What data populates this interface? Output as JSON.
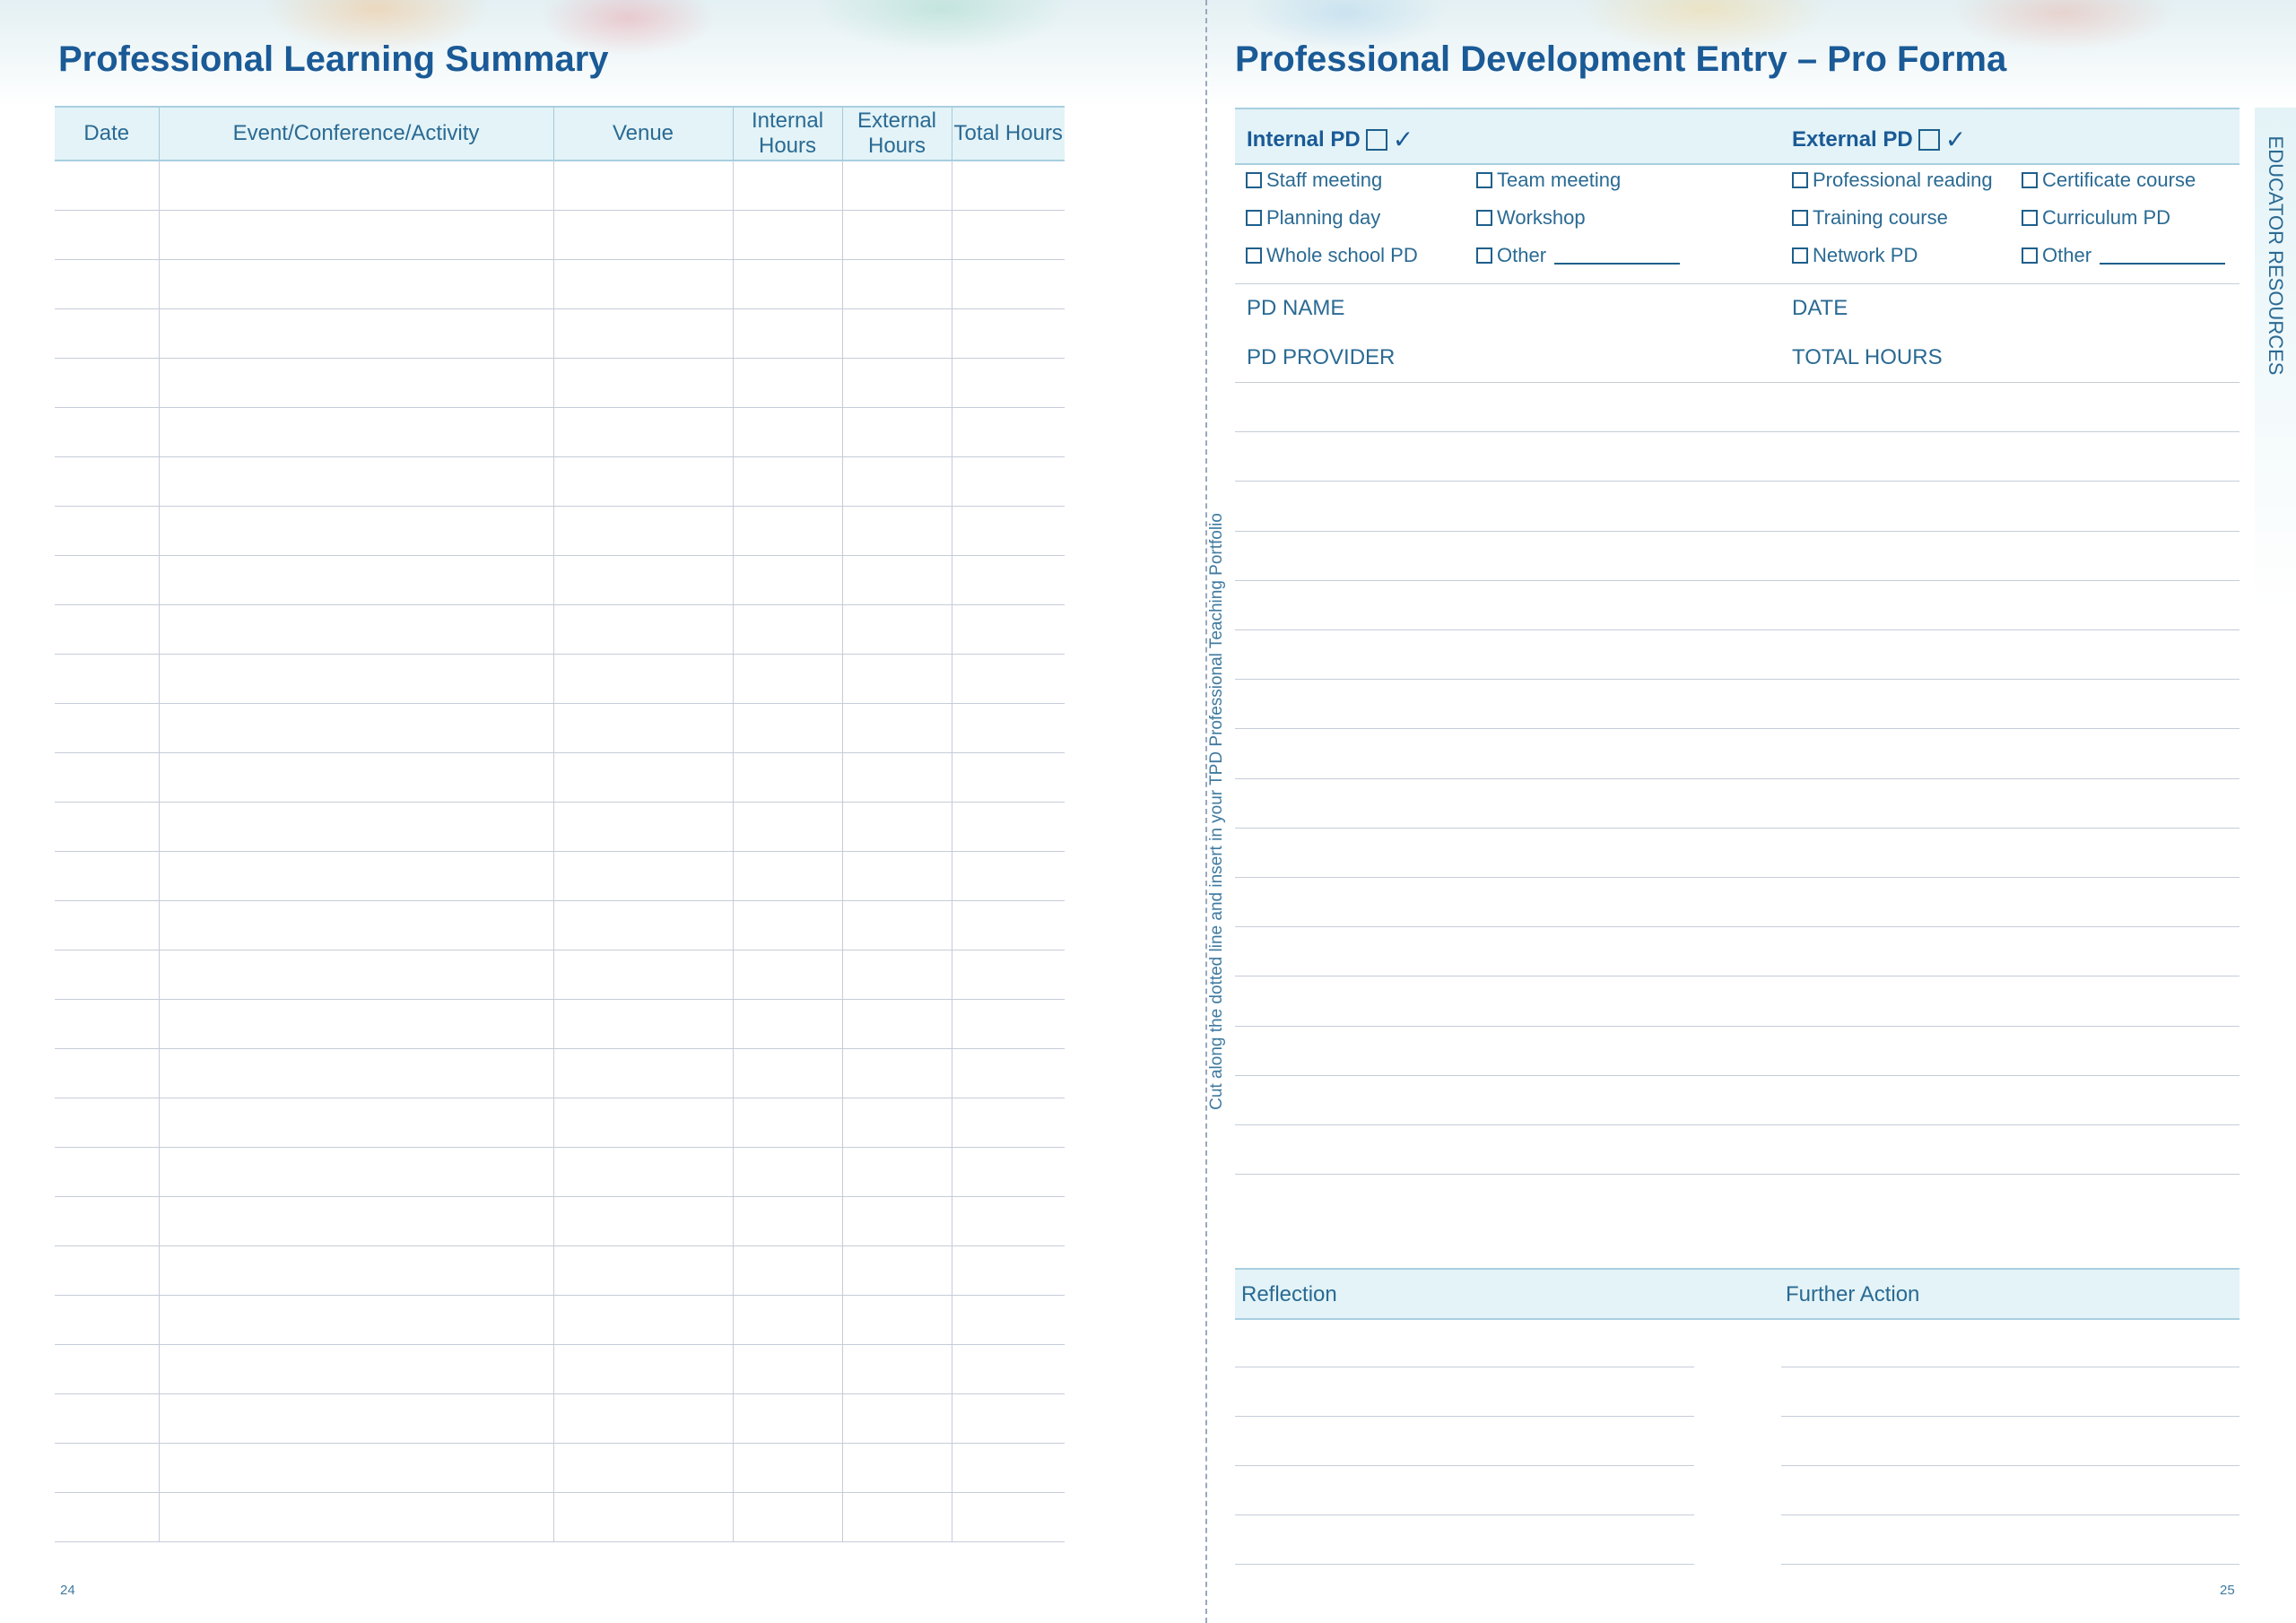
{
  "left_page": {
    "title": "Professional Learning Summary",
    "columns": [
      "Date",
      "Event/Conference/Activity",
      "Venue",
      "Internal Hours",
      "External Hours",
      "Total Hours"
    ],
    "row_count": 28,
    "page_number": "24"
  },
  "cut_note": "Cut along the dotted line and insert in your TPD Professional Teaching Portfolio",
  "right_page": {
    "title": "Professional Development Entry – Pro Forma",
    "internal_pd_label": "Internal PD",
    "external_pd_label": "External PD",
    "internal_options": [
      "Staff meeting",
      "Team meeting",
      "Planning day",
      "Workshop",
      "Whole school PD",
      "Other"
    ],
    "external_options": [
      "Professional reading",
      "Certificate course",
      "Training course",
      "Curriculum PD",
      "Network PD",
      "Other"
    ],
    "pd_name_label": "PD NAME",
    "date_label": "DATE",
    "pd_provider_label": "PD PROVIDER",
    "total_hours_label": "TOTAL HOURS",
    "reflection_label": "Reflection",
    "further_action_label": "Further Action",
    "side_tab": "EDUCATOR RESOURCES",
    "page_number": "25"
  },
  "colors": {
    "heading": "#1a5a96",
    "text": "#2a6a93",
    "band": "#e3f3f7",
    "rule": "#c6ccd8"
  }
}
